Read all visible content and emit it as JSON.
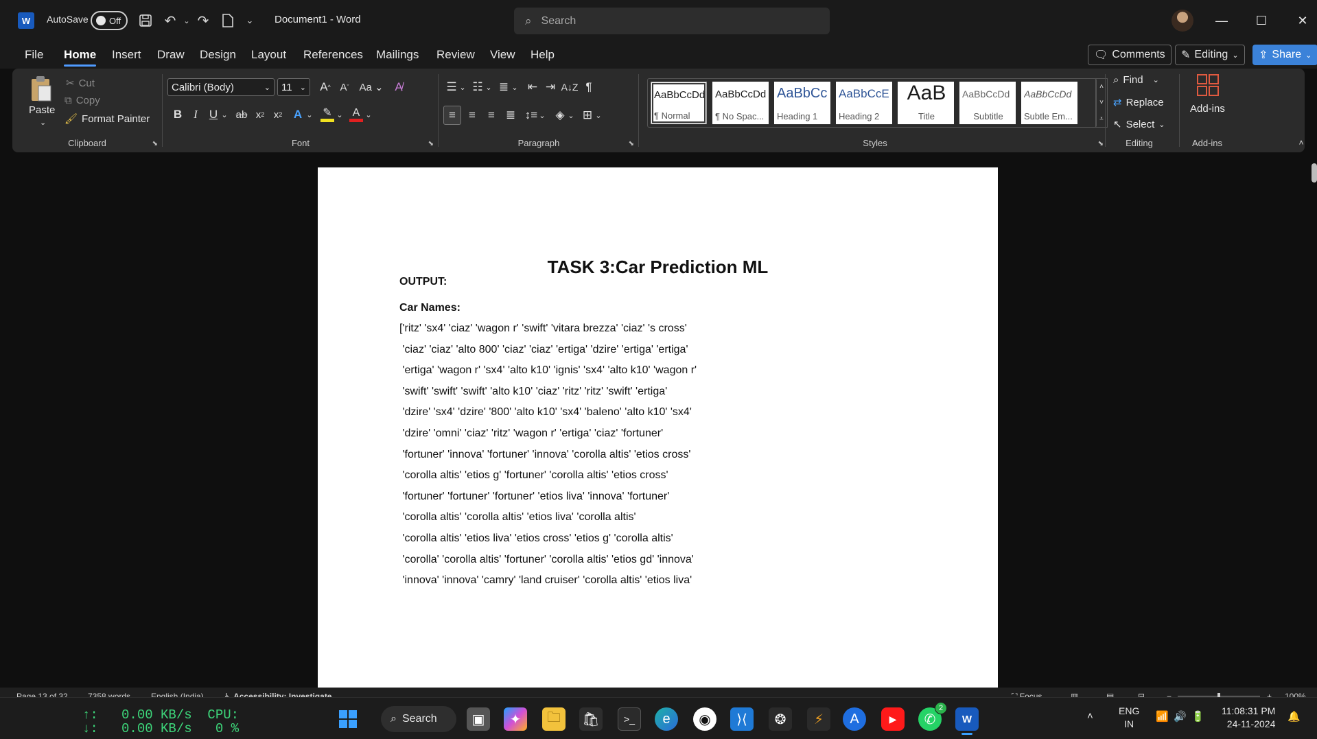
{
  "window": {
    "app_icon_label": "W",
    "autosave_label": "AutoSave",
    "autosave_state": "Off",
    "document_title": "Document1  -  Word",
    "search_placeholder": "Search"
  },
  "menu": {
    "tabs": [
      "File",
      "Home",
      "Insert",
      "Draw",
      "Design",
      "Layout",
      "References",
      "Mailings",
      "Review",
      "View",
      "Help"
    ],
    "active_tab": "Home",
    "comments_label": "Comments",
    "editing_label": "Editing",
    "share_label": "Share"
  },
  "ribbon": {
    "clipboard": {
      "paste": "Paste",
      "cut": "Cut",
      "copy": "Copy",
      "format_painter": "Format Painter",
      "label": "Clipboard"
    },
    "font": {
      "family": "Calibri (Body)",
      "size": "11",
      "label": "Font"
    },
    "paragraph": {
      "label": "Paragraph"
    },
    "styles": {
      "label": "Styles",
      "items": [
        {
          "sample": "AaBbCcDd",
          "name": "¶ Normal"
        },
        {
          "sample": "AaBbCcDd",
          "name": "¶ No Spac..."
        },
        {
          "sample": "AaBbCc",
          "name": "Heading 1"
        },
        {
          "sample": "AaBbCcE",
          "name": "Heading 2"
        },
        {
          "sample": "AaB",
          "name": "Title"
        },
        {
          "sample": "AaBbCcDd",
          "name": "Subtitle"
        },
        {
          "sample": "AaBbCcDd",
          "name": "Subtle Em..."
        }
      ]
    },
    "editing": {
      "find": "Find",
      "replace": "Replace",
      "select": "Select",
      "label": "Editing"
    },
    "addins": {
      "button": "Add-ins",
      "label": "Add-ins"
    }
  },
  "document": {
    "title": "TASK 3:Car Prediction ML",
    "output_label": "OUTPUT:",
    "car_names_label": "Car Names:",
    "lines": [
      "['ritz' 'sx4' 'ciaz' 'wagon r' 'swift' 'vitara brezza' 'ciaz' 's cross'",
      " 'ciaz' 'ciaz' 'alto 800' 'ciaz' 'ciaz' 'ertiga' 'dzire' 'ertiga' 'ertiga'",
      " 'ertiga' 'wagon r' 'sx4' 'alto k10' 'ignis' 'sx4' 'alto k10' 'wagon r'",
      " 'swift' 'swift' 'swift' 'alto k10' 'ciaz' 'ritz' 'ritz' 'swift' 'ertiga'",
      " 'dzire' 'sx4' 'dzire' '800' 'alto k10' 'sx4' 'baleno' 'alto k10' 'sx4'",
      " 'dzire' 'omni' 'ciaz' 'ritz' 'wagon r' 'ertiga' 'ciaz' 'fortuner'",
      " 'fortuner' 'innova' 'fortuner' 'innova' 'corolla altis' 'etios cross'",
      " 'corolla altis' 'etios g' 'fortuner' 'corolla altis' 'etios cross'",
      " 'fortuner' 'fortuner' 'fortuner' 'etios liva' 'innova' 'fortuner'",
      " 'corolla altis' 'corolla altis' 'etios liva' 'corolla altis'",
      " 'corolla altis' 'etios liva' 'etios cross' 'etios g' 'corolla altis'",
      " 'corolla' 'corolla altis' 'fortuner' 'corolla altis' 'etios gd' 'innova'",
      " 'innova' 'innova' 'camry' 'land cruiser' 'corolla altis' 'etios liva'"
    ]
  },
  "statusbar": {
    "page": "Page 13 of 32",
    "words": "7358 words",
    "language": "English (India)",
    "accessibility": "Accessibility: Investigate",
    "focus": "Focus",
    "zoom": "100%"
  },
  "taskbar": {
    "net_up": "↑:   0.00 KB/s  CPU:",
    "net_down": "↓:   0.00 KB/s   0 %",
    "search_label": "Search",
    "whatsapp_badge": "2",
    "lang_top": "ENG",
    "lang_bottom": "IN",
    "time": "11:08:31 PM",
    "date": "24-11-2024"
  }
}
